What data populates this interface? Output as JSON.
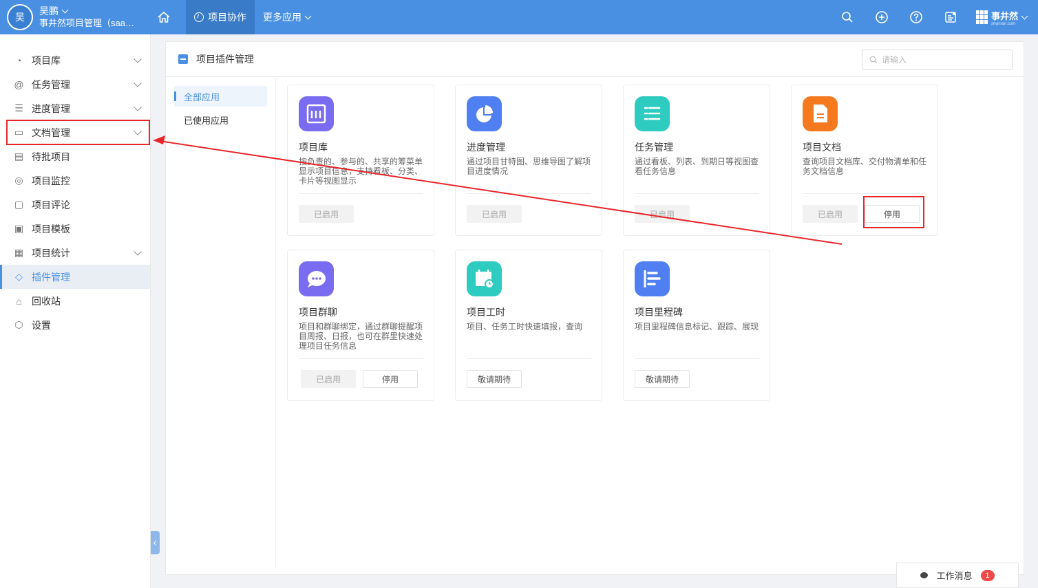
{
  "colors": {
    "topbar": "#4a90e2",
    "accent": "#4a90e2",
    "annotation": "#e8262a"
  },
  "user": {
    "avatar_char": "吴",
    "name": "吴鹏",
    "org": "事井然项目管理（saas..."
  },
  "topnav": {
    "home_icon": "home-icon",
    "active_tab": "项目协作",
    "more_apps": "更多应用"
  },
  "topbar_icons": [
    "search-icon",
    "plus-circle-icon",
    "help-icon",
    "notice-icon"
  ],
  "brand": {
    "name": "事井然",
    "sub": "shijinran.com"
  },
  "sidebar": {
    "items": [
      {
        "label": "项目库",
        "icon": "compass-icon",
        "expandable": true
      },
      {
        "label": "任务管理",
        "icon": "at-icon",
        "expandable": true
      },
      {
        "label": "进度管理",
        "icon": "gantt-icon",
        "expandable": true
      },
      {
        "label": "文档管理",
        "icon": "document-icon",
        "expandable": true
      },
      {
        "label": "待批项目",
        "icon": "approve-icon",
        "expandable": false
      },
      {
        "label": "项目监控",
        "icon": "monitor-icon",
        "expandable": false
      },
      {
        "label": "项目评论",
        "icon": "comment-icon",
        "expandable": false
      },
      {
        "label": "项目模板",
        "icon": "template-icon",
        "expandable": false
      },
      {
        "label": "项目统计",
        "icon": "stats-icon",
        "expandable": true
      },
      {
        "label": "插件管理",
        "icon": "plugin-icon",
        "expandable": false,
        "active": true
      },
      {
        "label": "回收站",
        "icon": "trash-icon",
        "expandable": false
      },
      {
        "label": "设置",
        "icon": "settings-icon",
        "expandable": false
      }
    ]
  },
  "main": {
    "title": "项目插件管理",
    "search_placeholder": "请输入",
    "subnav": [
      "全部应用",
      "已使用应用"
    ],
    "cards": [
      {
        "title": "项目库",
        "desc": "按负责的、参与的、共享的筹菜单显示项目信息，支持看板、分类、卡片等视图显示",
        "icon": "library-icon",
        "color": "#7a6cf0",
        "buttons": [
          {
            "label": "已启用",
            "style": "disabled"
          }
        ]
      },
      {
        "title": "进度管理",
        "desc": "通过项目甘特图、思维导图了解项目进度情况",
        "icon": "pie-chart-icon",
        "color": "#4f7ff0",
        "buttons": [
          {
            "label": "已启用",
            "style": "disabled"
          }
        ]
      },
      {
        "title": "任务管理",
        "desc": "通过看板、列表、到期日等视图查看任务信息",
        "icon": "list-icon",
        "color": "#2ecbc0",
        "buttons": [
          {
            "label": "已启用",
            "style": "disabled"
          }
        ]
      },
      {
        "title": "项目文档",
        "desc": "查询项目文档库、交付物清单和任务文档信息",
        "icon": "file-icon",
        "color": "#f57a1f",
        "buttons": [
          {
            "label": "已启用",
            "style": "disabled"
          },
          {
            "label": "停用",
            "style": "normal"
          }
        ]
      },
      {
        "title": "项目群聊",
        "desc": "项目和群聊绑定，通过群聊提醒项目周报、日报，也可在群里快速处理项目任务信息",
        "icon": "chat-icon",
        "color": "#7a6cf0",
        "buttons": [
          {
            "label": "已启用",
            "style": "disabled"
          },
          {
            "label": "停用",
            "style": "normal"
          }
        ]
      },
      {
        "title": "项目工时",
        "desc": "项目、任务工时快速填报，查询",
        "icon": "calendar-clock-icon",
        "color": "#2ecbc0",
        "buttons": [
          {
            "label": "敬请期待",
            "style": "normal"
          }
        ]
      },
      {
        "title": "项目里程碑",
        "desc": "项目里程碑信息标记、跟踪、展现",
        "icon": "milestone-icon",
        "color": "#4f7ff0",
        "buttons": [
          {
            "label": "敬请期待",
            "style": "normal"
          }
        ]
      }
    ]
  },
  "message_bar": {
    "label": "工作消息",
    "count": "1"
  }
}
